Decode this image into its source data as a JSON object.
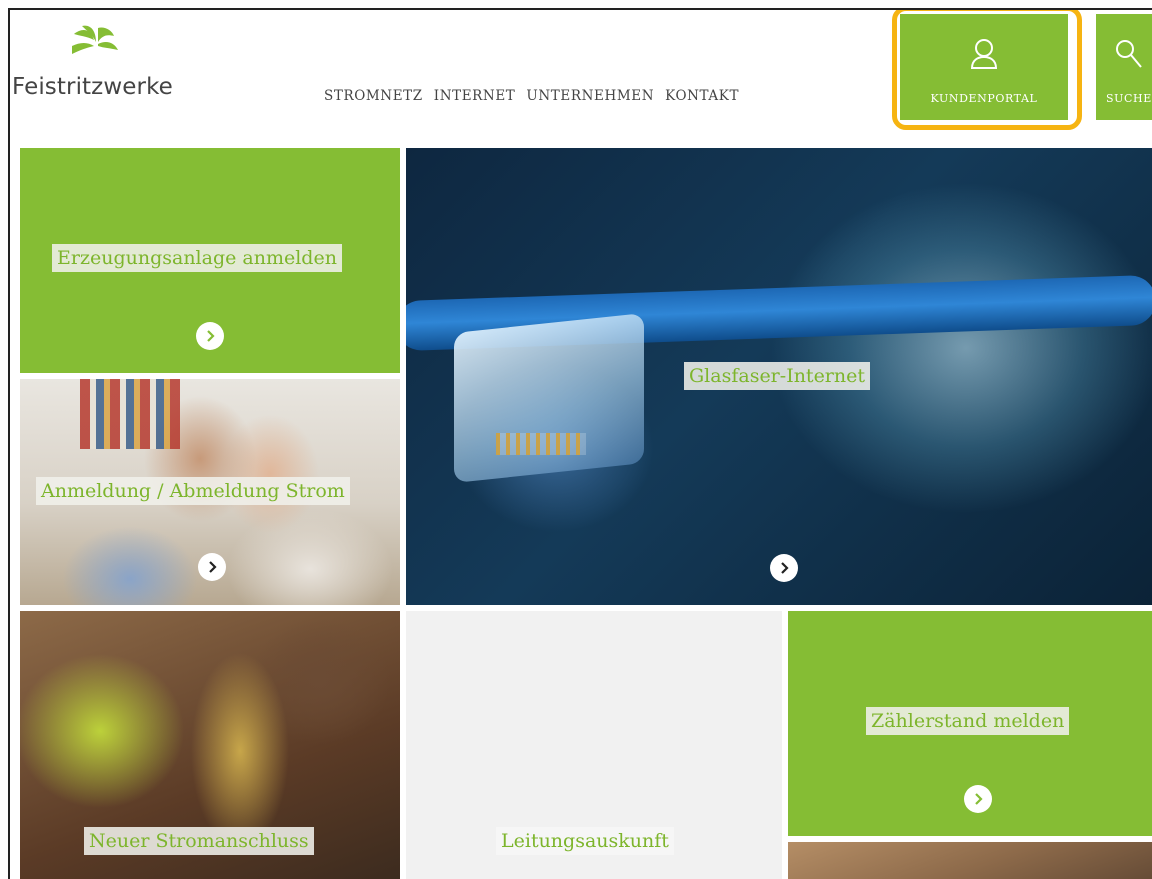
{
  "brand": {
    "name": "Feistritzwerke",
    "color": "#85bd34"
  },
  "nav": [
    {
      "label": "STROMNETZ"
    },
    {
      "label": "INTERNET"
    },
    {
      "label": "UNTERNEHMEN"
    },
    {
      "label": "KONTAKT"
    }
  ],
  "header_buttons": {
    "portal": {
      "label": "KUNDENPORTAL",
      "icon": "user-icon"
    },
    "search": {
      "label": "SUCHE",
      "icon": "search-icon"
    }
  },
  "highlight_color": "#f6b412",
  "tiles": {
    "erzeugung": {
      "title": "Erzeugungsanlage anmelden"
    },
    "anmeldung": {
      "title": "Anmeldung / Abmeldung Strom"
    },
    "glasfaser": {
      "title": "Glasfaser-Internet"
    },
    "stromanschluss": {
      "title": "Neuer Stromanschluss"
    },
    "leitung": {
      "title": "Leitungsauskunft"
    },
    "zaehler": {
      "title": "Zählerstand melden"
    }
  }
}
